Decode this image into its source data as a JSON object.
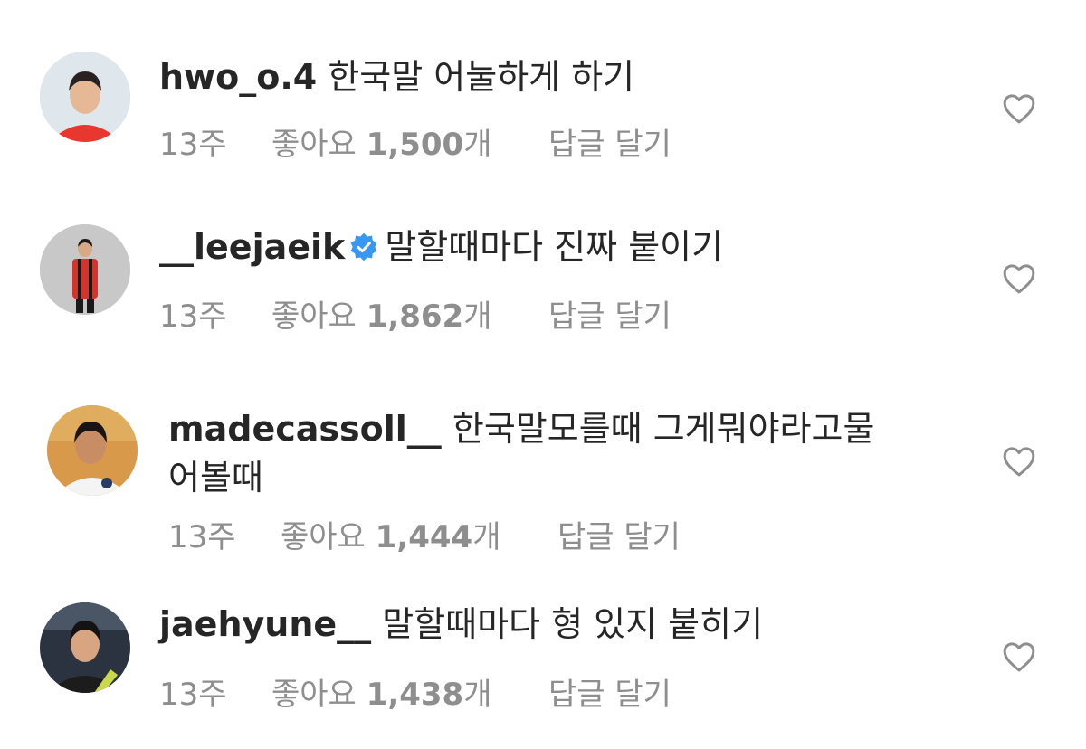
{
  "comments": [
    {
      "username": "hwo_o.4",
      "verified": false,
      "text_line1": "한국말 어눌하게 하기",
      "text_line2": "",
      "time": "13주",
      "likes_prefix": "좋아요",
      "likes_count": "1,500",
      "likes_suffix": "개",
      "reply_label": "답글 달기",
      "avatar_colors": {
        "bg": "#dfe6ec",
        "shirt": "#e8372f",
        "skin": "#e6b996",
        "hair": "#2a2222"
      }
    },
    {
      "username": "__leejaeik",
      "verified": true,
      "text_line1": "말할때마다 진짜 붙이기",
      "text_line2": "",
      "time": "13주",
      "likes_prefix": "좋아요",
      "likes_count": "1,862",
      "likes_suffix": "개",
      "reply_label": "답글 달기",
      "avatar_colors": {
        "bg": "#c8c8c8",
        "shirt": "#d4342c",
        "skin": "#d9a884",
        "hair": "#1e1a1a"
      }
    },
    {
      "username": "madecassoll__",
      "verified": false,
      "text_line1": "한국말모를때 그게뭐야라고물",
      "text_line2": "어볼때",
      "time": "13주",
      "likes_prefix": "좋아요",
      "likes_count": "1,444",
      "likes_suffix": "개",
      "reply_label": "답글 달기",
      "avatar_colors": {
        "bg": "#d89a4a",
        "shirt": "#f4f4f4",
        "skin": "#c98d66",
        "hair": "#1a1414"
      }
    },
    {
      "username": "jaehyune__",
      "verified": false,
      "text_line1": "말할때마다 형 있지 붙히기",
      "text_line2": "",
      "time": "13주",
      "likes_prefix": "좋아요",
      "likes_count": "1,438",
      "likes_suffix": "개",
      "reply_label": "답글 달기",
      "avatar_colors": {
        "bg": "#2b3340",
        "shirt": "#1c1c1c",
        "skin": "#d7a582",
        "hair": "#141212"
      }
    }
  ],
  "colors": {
    "text": "#262626",
    "meta": "#8e8e8e",
    "verified": "#3897f0",
    "heart": "#8e8e8e"
  },
  "icons": {
    "like": "heart-outline-icon",
    "verified": "verified-badge-icon"
  }
}
